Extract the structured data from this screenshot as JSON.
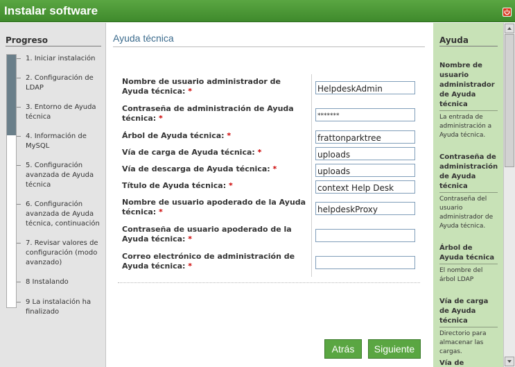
{
  "window": {
    "title": "Instalar software",
    "close_icon": "power-icon"
  },
  "progress": {
    "heading": "Progreso",
    "fraction_complete": 0.32,
    "steps": [
      {
        "label": "1. Iniciar instalación"
      },
      {
        "label": "2. Configuración de LDAP"
      },
      {
        "label": "3. Entorno de Ayuda técnica"
      },
      {
        "label": "4. Información de MySQL"
      },
      {
        "label": "5. Configuración avanzada de Ayuda técnica"
      },
      {
        "label": "6. Configuración avanzada de Ayuda técnica, continuación"
      },
      {
        "label": "7. Revisar valores de configuración (modo avanzado)"
      },
      {
        "label": "8 Instalando"
      },
      {
        "label": "9 La instalación ha finalizado"
      }
    ]
  },
  "main": {
    "heading": "Ayuda técnica",
    "required_marker": "*",
    "fields": [
      {
        "label": "Nombre de usuario administrador de Ayuda técnica:",
        "value": "HelpdeskAdmin"
      },
      {
        "label": "Contraseña de administración de Ayuda técnica:",
        "value": "*******"
      },
      {
        "label": "Árbol de Ayuda técnica:",
        "value": "frattonparktree"
      },
      {
        "label": "Vía de carga de Ayuda técnica:",
        "value": "uploads"
      },
      {
        "label": "Vía de descarga de Ayuda técnica:",
        "value": "uploads"
      },
      {
        "label": "Título de Ayuda técnica:",
        "value": "context Help Desk"
      },
      {
        "label": "Nombre de usuario apoderado de la Ayuda técnica:",
        "value": "helpdeskProxy"
      },
      {
        "label": "Contraseña de usuario apoderado de la Ayuda técnica:",
        "value": ""
      },
      {
        "label": "Correo electrónico de administración de Ayuda técnica:",
        "value": ""
      }
    ],
    "back_label": "Atrás",
    "next_label": "Siguiente"
  },
  "help": {
    "heading": "Ayuda",
    "items": [
      {
        "title": "Nombre de usuario administrador de Ayuda técnica",
        "desc": "La entrada de administración a Ayuda técnica."
      },
      {
        "title": "Contraseña de administración de Ayuda técnica",
        "desc": "Contraseña del usuario administrador de Ayuda técnica."
      },
      {
        "title": "Árbol de Ayuda técnica",
        "desc": "El nombre del árbol LDAP"
      },
      {
        "title": "Vía de carga de Ayuda técnica",
        "desc": "Directorio para almacenar las cargas."
      },
      {
        "title": "Vía de",
        "desc": ""
      }
    ]
  },
  "colors": {
    "titlebar": "#4a9a35",
    "help_bg": "#c8e2b7",
    "button": "#5aa642",
    "heading_blue": "#3a6a8c",
    "required": "#cc0000"
  }
}
